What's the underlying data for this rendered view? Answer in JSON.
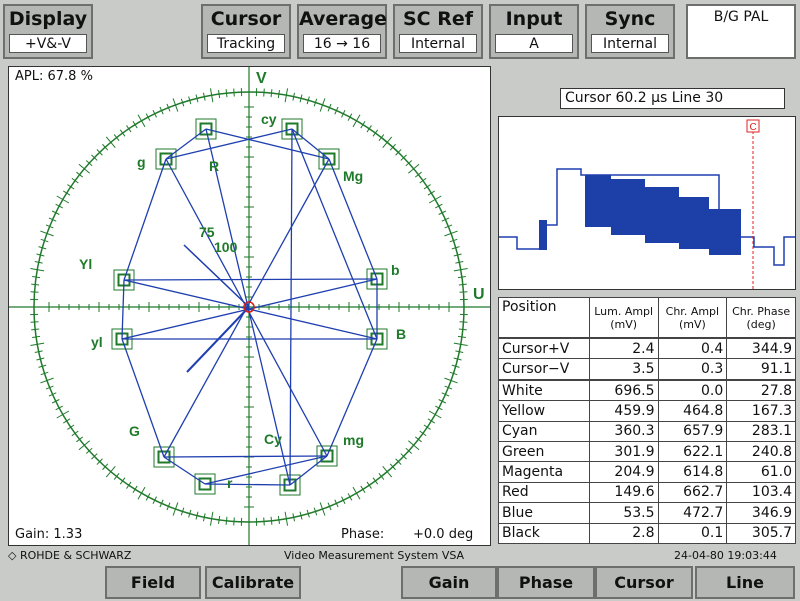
{
  "top_buttons": {
    "display": {
      "label": "Display",
      "value": "+V&-V"
    },
    "cursor": {
      "label": "Cursor",
      "value": "Tracking"
    },
    "average": {
      "label": "Average",
      "value": "16 → 16"
    },
    "sc_ref": {
      "label": "SC Ref",
      "value": "Internal"
    },
    "input": {
      "label": "Input",
      "value": "A"
    },
    "sync": {
      "label": "Sync",
      "value": "Internal"
    }
  },
  "standard": "B/G PAL",
  "vectorscope": {
    "apl": "APL: 67.8 %",
    "gain": "Gain:  1.33",
    "phase": "Phase:",
    "phase_value": "+0.0 deg",
    "axis_v": "V",
    "axis_u": "U",
    "labels": {
      "cy_upper": "cy",
      "g_upper": "g",
      "r_upper": "R",
      "mg_upper": "Mg",
      "yl_upper": "Yl",
      "b_upper": "b",
      "yl_lower": "yl",
      "b_lower": "B",
      "g_lower": "G",
      "cy_lower": "Cy",
      "mg_lower": "mg",
      "r_lower": "r",
      "pct_75": "75",
      "pct_100": "100"
    }
  },
  "cursor_position": "Cursor  60.2 µs  Line  30",
  "waveform": {
    "cursor_marker": "C"
  },
  "table": {
    "headers": {
      "position": "Position",
      "lum": "Lum. Ampl",
      "lum_unit": "(mV)",
      "chr": "Chr. Ampl",
      "chr_unit": "(mV)",
      "phase": "Chr. Phase",
      "phase_unit": "(deg)"
    },
    "cursor_rows": [
      {
        "name": "Cursor+V",
        "lum": "2.4",
        "chr": "0.4",
        "phase": "344.9"
      },
      {
        "name": "Cursor−V",
        "lum": "3.5",
        "chr": "0.3",
        "phase": "91.1"
      }
    ],
    "color_rows": [
      {
        "name": "White",
        "lum": "696.5",
        "chr": "0.0",
        "phase": "27.8"
      },
      {
        "name": "Yellow",
        "lum": "459.9",
        "chr": "464.8",
        "phase": "167.3"
      },
      {
        "name": "Cyan",
        "lum": "360.3",
        "chr": "657.9",
        "phase": "283.1"
      },
      {
        "name": "Green",
        "lum": "301.9",
        "chr": "622.1",
        "phase": "240.8"
      },
      {
        "name": "Magenta",
        "lum": "204.9",
        "chr": "614.8",
        "phase": "61.0"
      },
      {
        "name": "Red",
        "lum": "149.6",
        "chr": "662.7",
        "phase": "103.4"
      },
      {
        "name": "Blue",
        "lum": "53.5",
        "chr": "472.7",
        "phase": "346.9"
      },
      {
        "name": "Black",
        "lum": "2.8",
        "chr": "0.1",
        "phase": "305.7"
      }
    ]
  },
  "status": {
    "brand": "ROHDE & SCHWARZ",
    "system": "Video Measurement System VSA",
    "datetime": "24-04-80  19:03:44"
  },
  "bottom_buttons": {
    "field": "Field",
    "calibrate": "Calibrate",
    "gain": "Gain",
    "phase": "Phase",
    "cursor": "Cursor",
    "line": "Line"
  },
  "colors": {
    "graticule": "#1f7a2a",
    "trace": "#1f3fb0",
    "cursor_marker": "#e02020"
  }
}
